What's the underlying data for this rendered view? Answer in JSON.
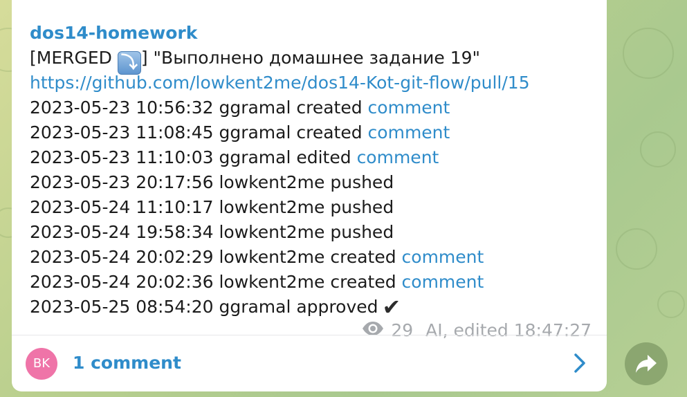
{
  "message": {
    "sender": "dos14-homework",
    "title_prefix": "[MERGED ",
    "title_emoji": "⤵",
    "title_suffix": "] \"Выполнено домашнее задание 19\"",
    "link": "https://github.com/lowkent2me/dos14-Kot-git-flow/pull/15",
    "events": [
      {
        "text": "2023-05-23 10:56:32 ggramal created ",
        "link": "comment"
      },
      {
        "text": "2023-05-23 11:08:45 ggramal created ",
        "link": "comment"
      },
      {
        "text": "2023-05-23 11:10:03 ggramal edited ",
        "link": "comment"
      },
      {
        "text": "2023-05-23 20:17:56 lowkent2me pushed",
        "link": ""
      },
      {
        "text": "2023-05-24 11:10:17 lowkent2me pushed",
        "link": ""
      },
      {
        "text": "2023-05-24 19:58:34 lowkent2me pushed",
        "link": ""
      },
      {
        "text": "2023-05-24 20:02:29 lowkent2me created ",
        "link": "comment"
      },
      {
        "text": "2023-05-24 20:02:36 lowkent2me created ",
        "link": "comment"
      },
      {
        "text": "2023-05-25 08:54:20 ggramal approved",
        "link": ""
      }
    ],
    "approved_mark": "✔",
    "views": "29",
    "edited_info": "AI, edited 18:47:27"
  },
  "comments": {
    "avatar_initials": "BK",
    "label": "1 comment"
  },
  "colors": {
    "accent": "#2f8cca",
    "avatar": "#ef74a8",
    "meta": "#a6a9ad"
  },
  "icons": {
    "views": "eye-icon",
    "open_comments": "chevron-right-icon",
    "share": "share-arrow-icon"
  }
}
